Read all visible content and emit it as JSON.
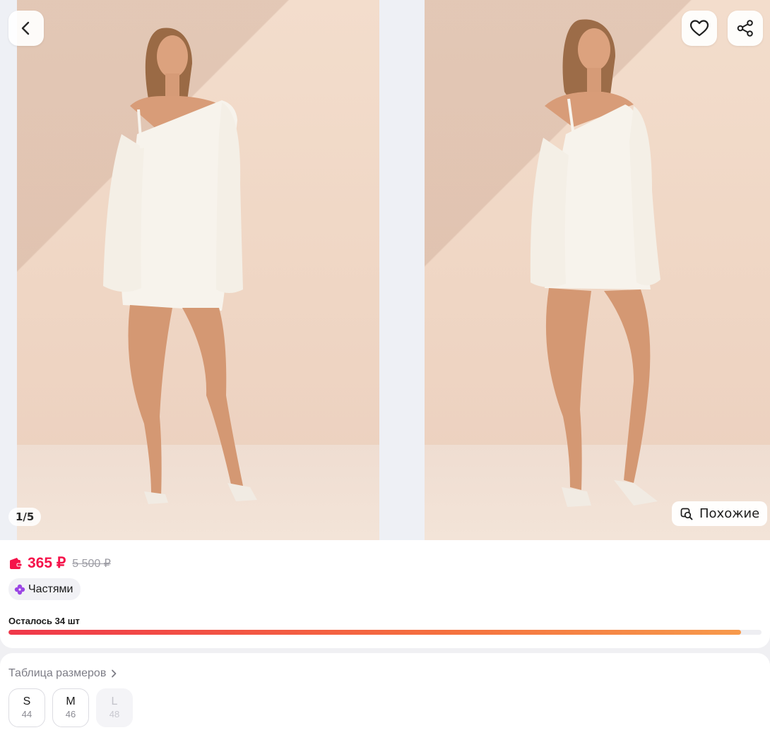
{
  "gallery": {
    "counter": "1/5",
    "similar_label": "Похожие",
    "images": [
      {
        "alt": "photo-1"
      },
      {
        "alt": "photo-2"
      }
    ]
  },
  "price": {
    "current": "365 ₽",
    "old": "5 500 ₽",
    "installments_label": "Частями"
  },
  "stock": {
    "label": "Осталось 34 шт",
    "remaining_fraction": 0.973
  },
  "sizes": {
    "table_link": "Таблица размеров",
    "options": [
      {
        "letter": "S",
        "number": "44",
        "available": true
      },
      {
        "letter": "M",
        "number": "46",
        "available": true
      },
      {
        "letter": "L",
        "number": "48",
        "available": false
      }
    ]
  },
  "colors": {
    "accent": "#f5124a",
    "installments_icon": "#9b45e4"
  },
  "icons": {
    "back": "chevron-left-icon",
    "favorite": "heart-icon",
    "share": "share-icon",
    "similar": "search-similar-icon",
    "price_badge": "wallet-icon",
    "installments": "flower-icon",
    "size_table": "chevron-right-icon"
  }
}
